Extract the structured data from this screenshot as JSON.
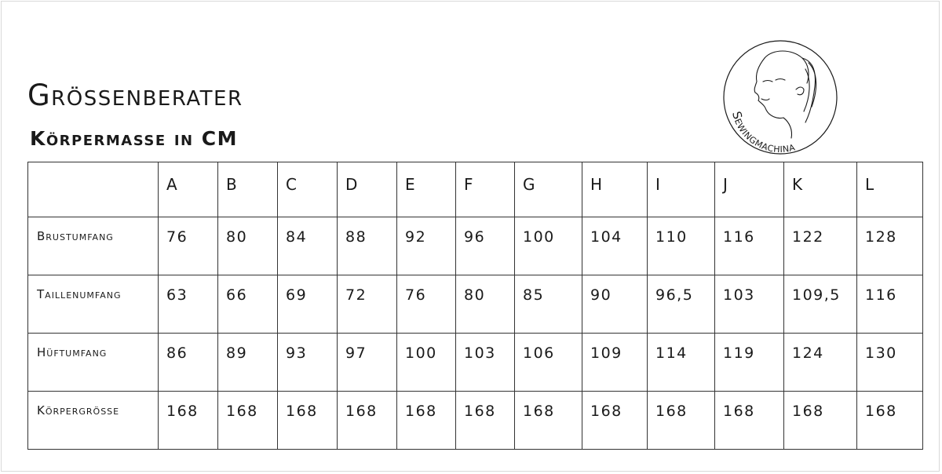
{
  "page": {
    "title": "Grössenberater",
    "subtitle": "Körpermasse in CM",
    "logo_text": "Sewingmachina"
  },
  "table": {
    "columns": [
      "A",
      "B",
      "C",
      "D",
      "E",
      "F",
      "G",
      "H",
      "I",
      "J",
      "K",
      "L"
    ],
    "rows": [
      {
        "label": "Brustumfang",
        "values": [
          "76",
          "80",
          "84",
          "88",
          "92",
          "96",
          "100",
          "104",
          "110",
          "116",
          "122",
          "128"
        ]
      },
      {
        "label": "Taillenumfang",
        "values": [
          "63",
          "66",
          "69",
          "72",
          "76",
          "80",
          "85",
          "90",
          "96,5",
          "103",
          "109,5",
          "116"
        ]
      },
      {
        "label": "Hüftumfang",
        "values": [
          "86",
          "89",
          "93",
          "97",
          "100",
          "103",
          "106",
          "109",
          "114",
          "119",
          "124",
          "130"
        ]
      },
      {
        "label": "Körpergrösse",
        "values": [
          "168",
          "168",
          "168",
          "168",
          "168",
          "168",
          "168",
          "168",
          "168",
          "168",
          "168",
          "168"
        ]
      }
    ]
  },
  "colors": {
    "ink": "#1a1a1a",
    "grid": "#333333",
    "background": "#ffffff"
  }
}
